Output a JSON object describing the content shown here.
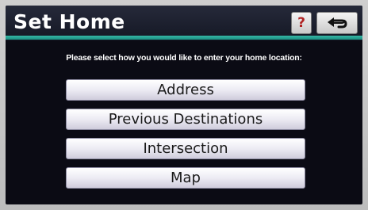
{
  "header": {
    "title": "Set Home",
    "help_label": "?",
    "back_label": "↩"
  },
  "prompt": "Please select how you would like to enter your home location:",
  "menu": {
    "items": [
      {
        "label": "Address"
      },
      {
        "label": "Previous Destinations"
      },
      {
        "label": "Intersection"
      },
      {
        "label": "Map"
      }
    ]
  },
  "colors": {
    "accent": "#1b8f82",
    "screen_background": "#0b0b14",
    "help_red": "#b02222"
  }
}
